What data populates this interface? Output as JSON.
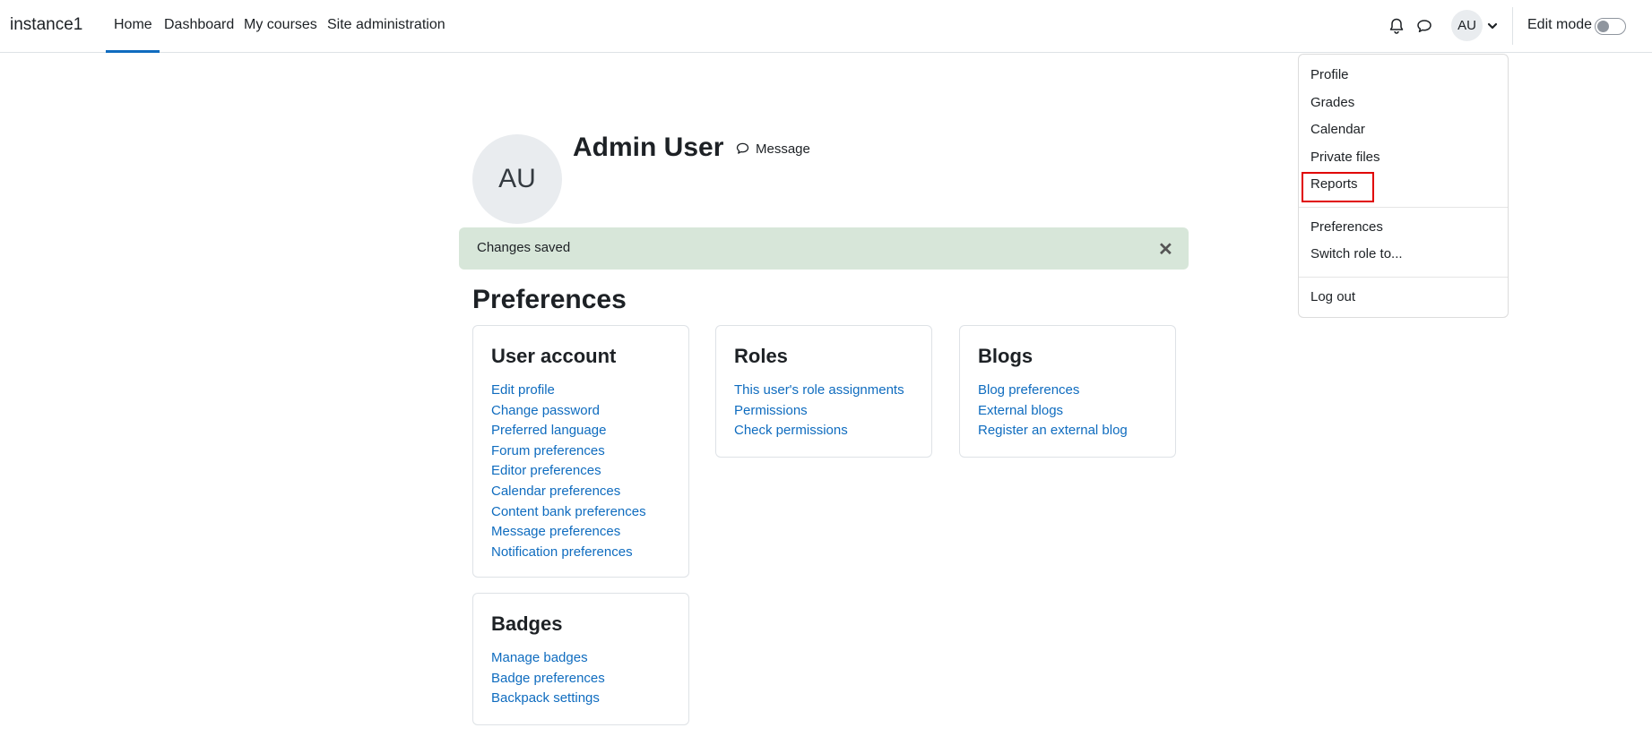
{
  "navbar": {
    "brand": "instance1",
    "items": [
      {
        "label": "Home"
      },
      {
        "label": "Dashboard"
      },
      {
        "label": "My courses"
      },
      {
        "label": "Site administration"
      }
    ],
    "avatar_initials": "AU",
    "edit_mode_label": "Edit mode",
    "edit_mode_on": false
  },
  "user_menu": {
    "group1": [
      "Profile",
      "Grades",
      "Calendar",
      "Private files",
      "Reports"
    ],
    "group2": [
      "Preferences",
      "Switch role to..."
    ],
    "group3": [
      "Log out"
    ]
  },
  "header": {
    "avatar_initials": "AU",
    "name": "Admin User",
    "message_label": "Message"
  },
  "alert": {
    "text": "Changes saved",
    "close": "✕"
  },
  "page_title": "Preferences",
  "cards": {
    "user_account": {
      "title": "User account",
      "links": [
        "Edit profile",
        "Change password",
        "Preferred language",
        "Forum preferences",
        "Editor preferences",
        "Calendar preferences",
        "Content bank preferences",
        "Message preferences",
        "Notification preferences"
      ]
    },
    "roles": {
      "title": "Roles",
      "links": [
        "This user's role assignments",
        "Permissions",
        "Check permissions"
      ]
    },
    "blogs": {
      "title": "Blogs",
      "links": [
        "Blog preferences",
        "External blogs",
        "Register an external blog"
      ]
    },
    "badges": {
      "title": "Badges",
      "links": [
        "Manage badges",
        "Badge preferences",
        "Backpack settings"
      ]
    }
  },
  "colors": {
    "link": "#0f6cbf",
    "alert_bg": "#d7e6d9",
    "highlight": "#e00000"
  }
}
